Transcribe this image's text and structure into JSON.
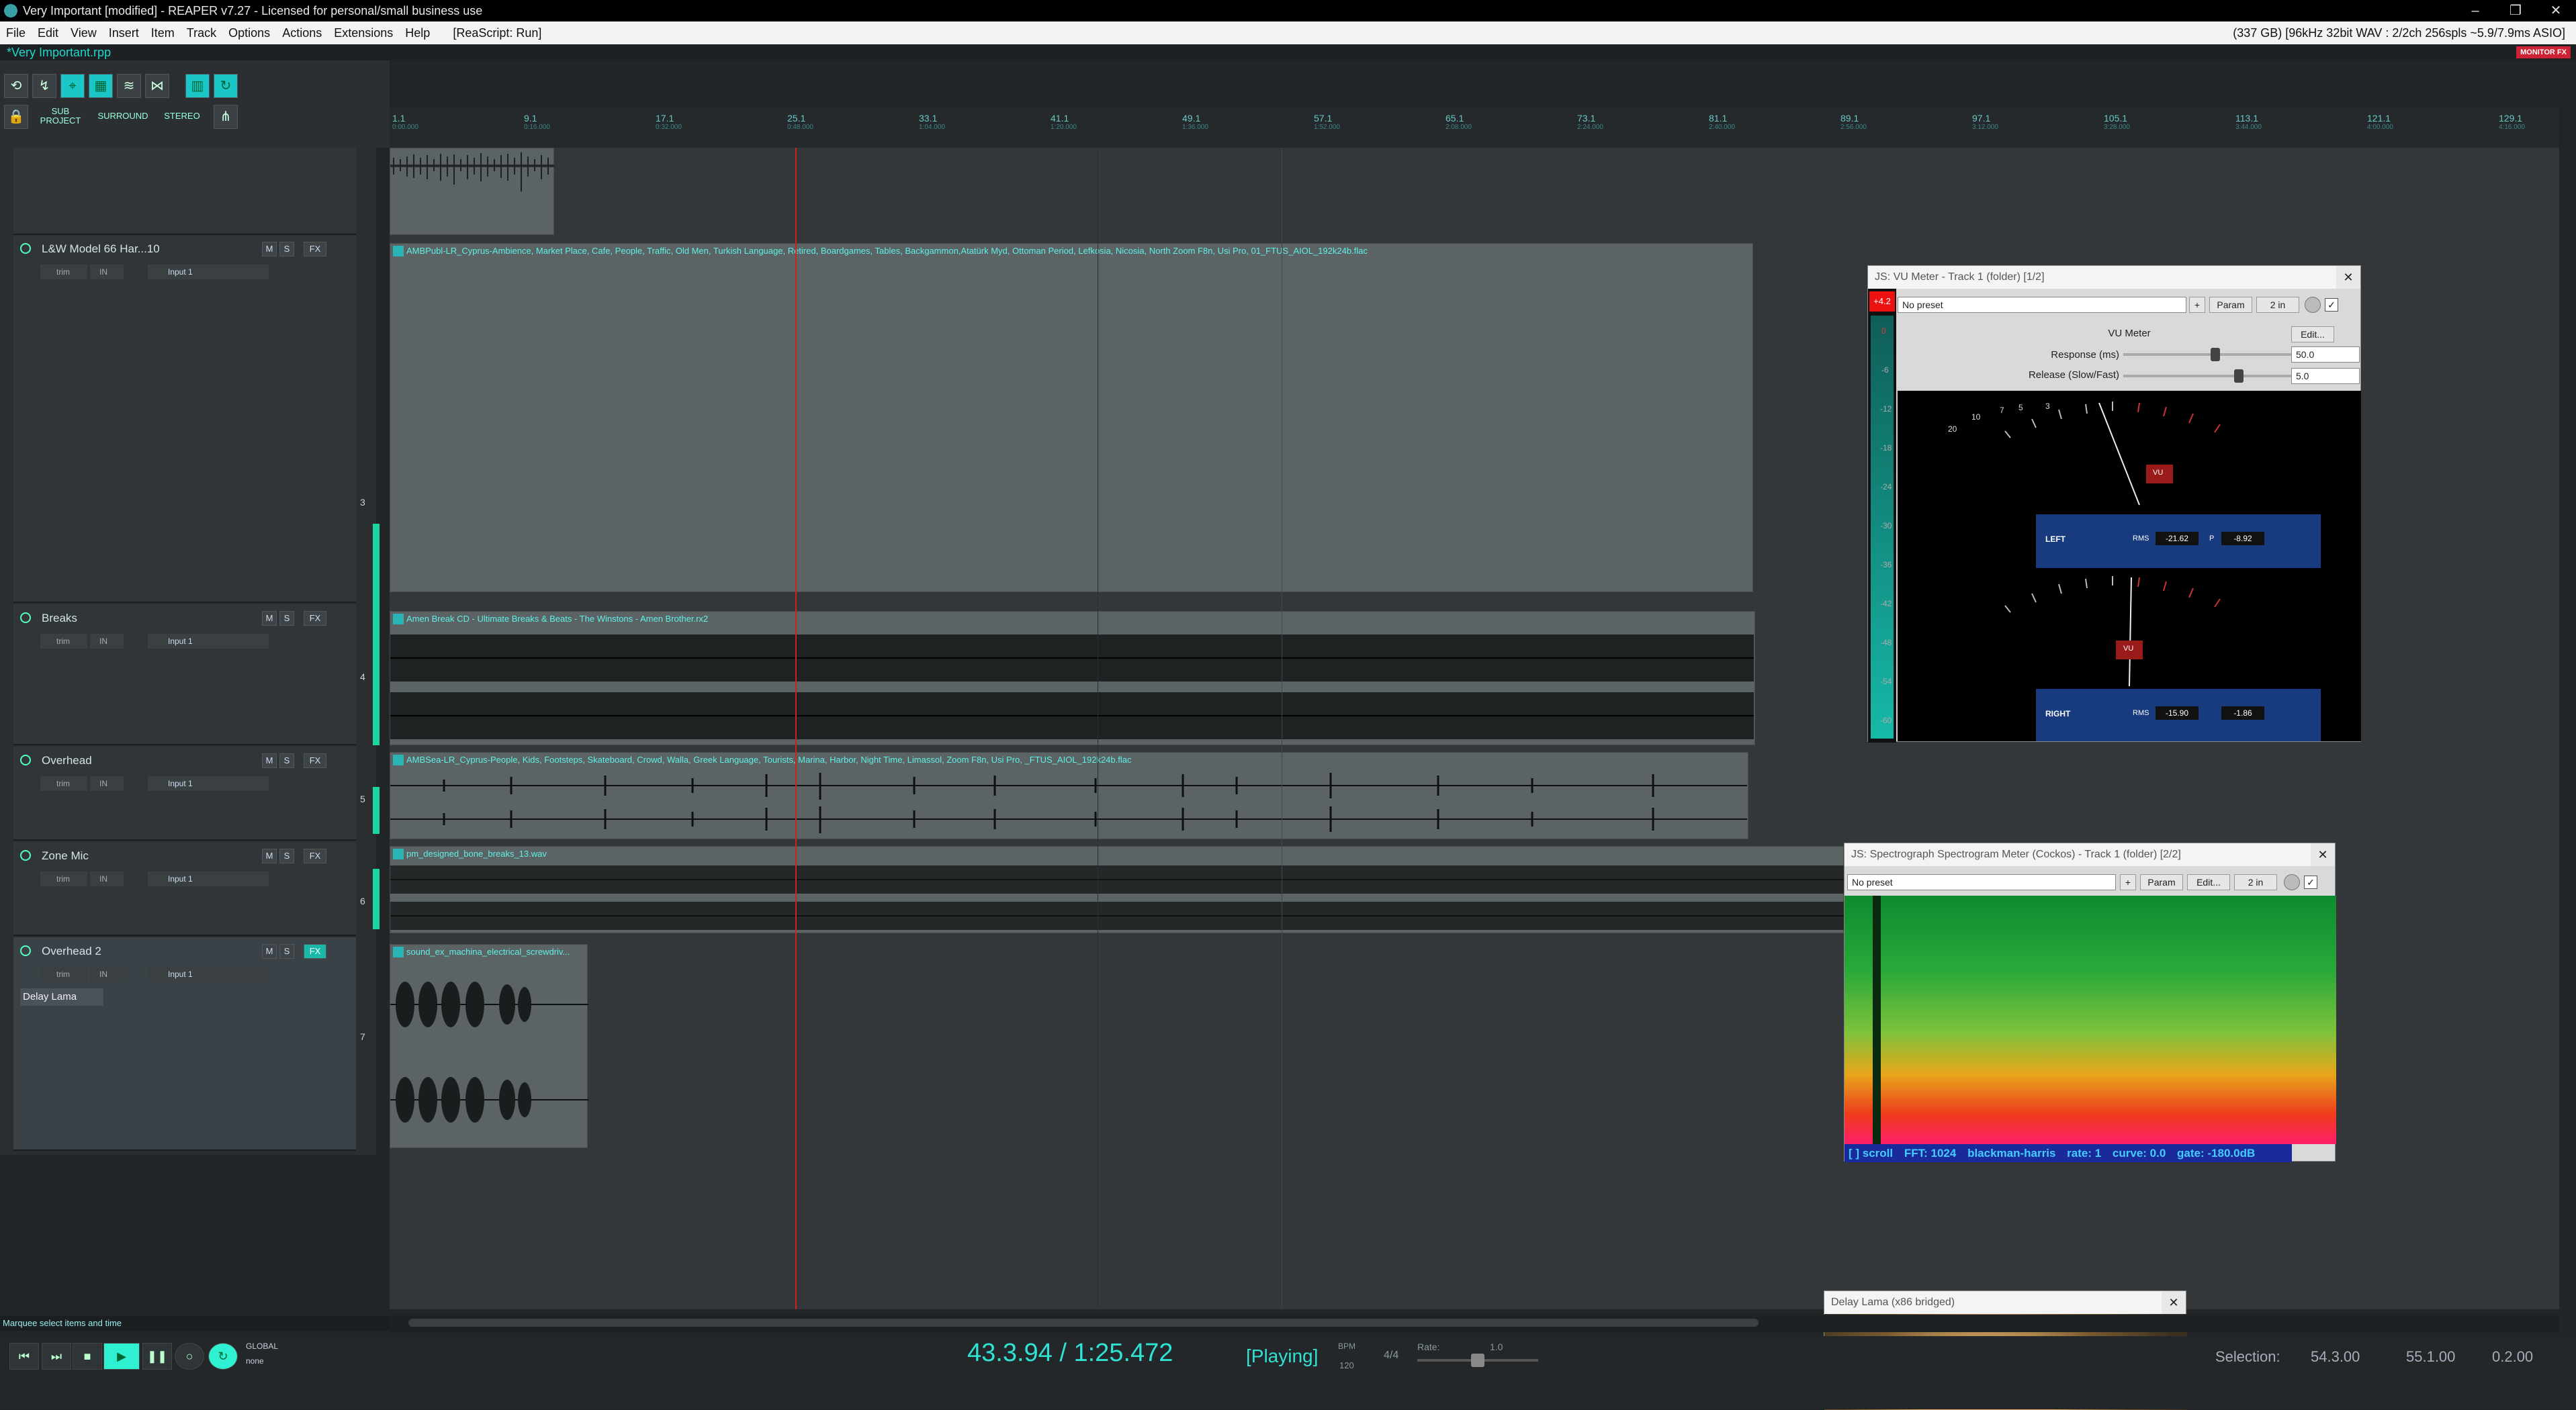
{
  "window": {
    "title": "Very Important [modified] - REAPER v7.27 - Licensed for personal/small business use",
    "controls": [
      "–",
      "❐",
      "✕"
    ]
  },
  "menu": {
    "items": [
      "File",
      "Edit",
      "View",
      "Insert",
      "Item",
      "Track",
      "Options",
      "Actions",
      "Extensions",
      "Help"
    ],
    "script": "[ReaScript: Run]",
    "status": "(337 GB) [96kHz 32bit WAV : 2/2ch 256spls ~5.9/7.9ms ASIO]"
  },
  "project_tab": {
    "label": "*Very Important.rpp",
    "monitor_fx": "MONITOR FX"
  },
  "toolbar": {
    "sub_project": "SUB PROJECT",
    "surround": "SURROUND",
    "stereo": "STEREO"
  },
  "ruler": {
    "ticks": [
      {
        "bar": "1.1",
        "time": "0:00.000"
      },
      {
        "bar": "9.1",
        "time": "0:16.000"
      },
      {
        "bar": "17.1",
        "time": "0:32.000"
      },
      {
        "bar": "25.1",
        "time": "0:48.000"
      },
      {
        "bar": "33.1",
        "time": "1:04.000"
      },
      {
        "bar": "41.1",
        "time": "1:20.000"
      },
      {
        "bar": "49.1",
        "time": "1:36.000"
      },
      {
        "bar": "57.1",
        "time": "1:52.000"
      },
      {
        "bar": "65.1",
        "time": "2:08.000"
      },
      {
        "bar": "73.1",
        "time": "2:24.000"
      },
      {
        "bar": "81.1",
        "time": "2:40.000"
      },
      {
        "bar": "89.1",
        "time": "2:56.000"
      },
      {
        "bar": "97.1",
        "time": "3:12.000"
      },
      {
        "bar": "105.1",
        "time": "3:28.000"
      },
      {
        "bar": "113.1",
        "time": "3:44.000"
      },
      {
        "bar": "121.1",
        "time": "4:00.000"
      },
      {
        "bar": "129.1",
        "time": "4:16.000"
      }
    ]
  },
  "tracks": [
    {
      "name": "L&W Model 66 Har...10",
      "number": "3",
      "input": "Input 1",
      "trim": "trim",
      "in": "IN"
    },
    {
      "name": "Breaks",
      "number": "4",
      "input": "Input 1",
      "trim": "trim",
      "in": "IN"
    },
    {
      "name": "Overhead",
      "number": "5",
      "input": "Input 1",
      "trim": "trim",
      "in": "IN"
    },
    {
      "name": "Zone Mic",
      "number": "6",
      "input": "Input 1",
      "trim": "trim",
      "in": "IN"
    },
    {
      "name": "Overhead 2",
      "number": "7",
      "input": "Input 1",
      "trim": "trim",
      "in": "IN",
      "plugin": "Delay Lama"
    }
  ],
  "track_buttons": {
    "mute": "M",
    "solo": "S",
    "fx": "FX"
  },
  "items": [
    {
      "label": "AMBPubl-LR_Cyprus-Ambience, Market Place, Cafe, People, Traffic, Old Men, Turkish Language, Retired, Boardgames, Tables, Backgammon,Atatürk Myd, Ottoman Period, Lefkosia, Nicosia, North Zoom F8n, Usi Pro, 01_FTUS_AIOL_192k24b.flac"
    },
    {
      "label": "Amen Break CD - Ultimate Breaks & Beats - The Winstons - Amen Brother.rx2"
    },
    {
      "label": "AMBSea-LR_Cyprus-People, Kids, Footsteps, Skateboard, Crowd, Walla, Greek Language, Tourists, Marina, Harbor, Night Time, Limassol, Zoom F8n, Usi Pro, _FTUS_AIOL_192k24b.flac"
    },
    {
      "label": "pm_designed_bone_breaks_13.wav"
    },
    {
      "label": "sound_ex_machina_electrical_screwdriv..."
    }
  ],
  "vu_meter": {
    "title": "JS: VU Meter - Track 1 (folder) [1/2]",
    "preset": "No preset",
    "plus": "+",
    "param": "Param",
    "io": "2 in",
    "heading": "VU Meter",
    "edit": "Edit...",
    "response_label": "Response (ms)",
    "response_value": "50.0",
    "response_level": 0.55,
    "release_label": "Release (Slow/Fast)",
    "release_value": "5.0",
    "release_level": 0.7,
    "left_label": "LEFT",
    "left_rms": "-21.62",
    "left_peak": "-8.92",
    "right_label": "RIGHT",
    "right_rms": "-15.90",
    "right_peak": "-1.86",
    "rms_label": "RMS",
    "peak_label": "P",
    "vu_label": "VU",
    "clip": "+4.2",
    "scale": [
      "0",
      "-6",
      "-12",
      "-18",
      "-24",
      "-30",
      "-36",
      "-42",
      "-48",
      "-54",
      "-60"
    ],
    "dial_marks": [
      "20",
      "10",
      "7",
      "5",
      "3"
    ]
  },
  "spectrogram": {
    "title": "JS: Spectrograph Spectrogram Meter (Cockos) - Track 1 (folder) [2/2]",
    "preset": "No preset",
    "plus": "+",
    "param": "Param",
    "edit": "Edit...",
    "io": "2 in",
    "footer": [
      "[ ] scroll",
      "FFT: 1024",
      "blackman-harris",
      "rate: 1",
      "curve: 0.0",
      "gate: -180.0dB"
    ]
  },
  "delay_lama": {
    "title": "Delay Lama (x86 bridged)"
  },
  "status_line": "Marquee select items and time",
  "transport": {
    "time": "43.3.94 / 1:25.472",
    "state": "[Playing]",
    "bpm_label": "BPM",
    "bpm": "120",
    "signature": "4/4",
    "rate_label": "Rate:",
    "rate": "1.0",
    "global": "GLOBAL",
    "none": "none",
    "selection_label": "Selection:",
    "sel_start": "54.3.00",
    "sel_end": "55.1.00",
    "sel_len": "0.2.00"
  },
  "colors": {
    "accent": "#1fd7c9",
    "item": "#5b6365",
    "cursor": "#cc2222"
  }
}
